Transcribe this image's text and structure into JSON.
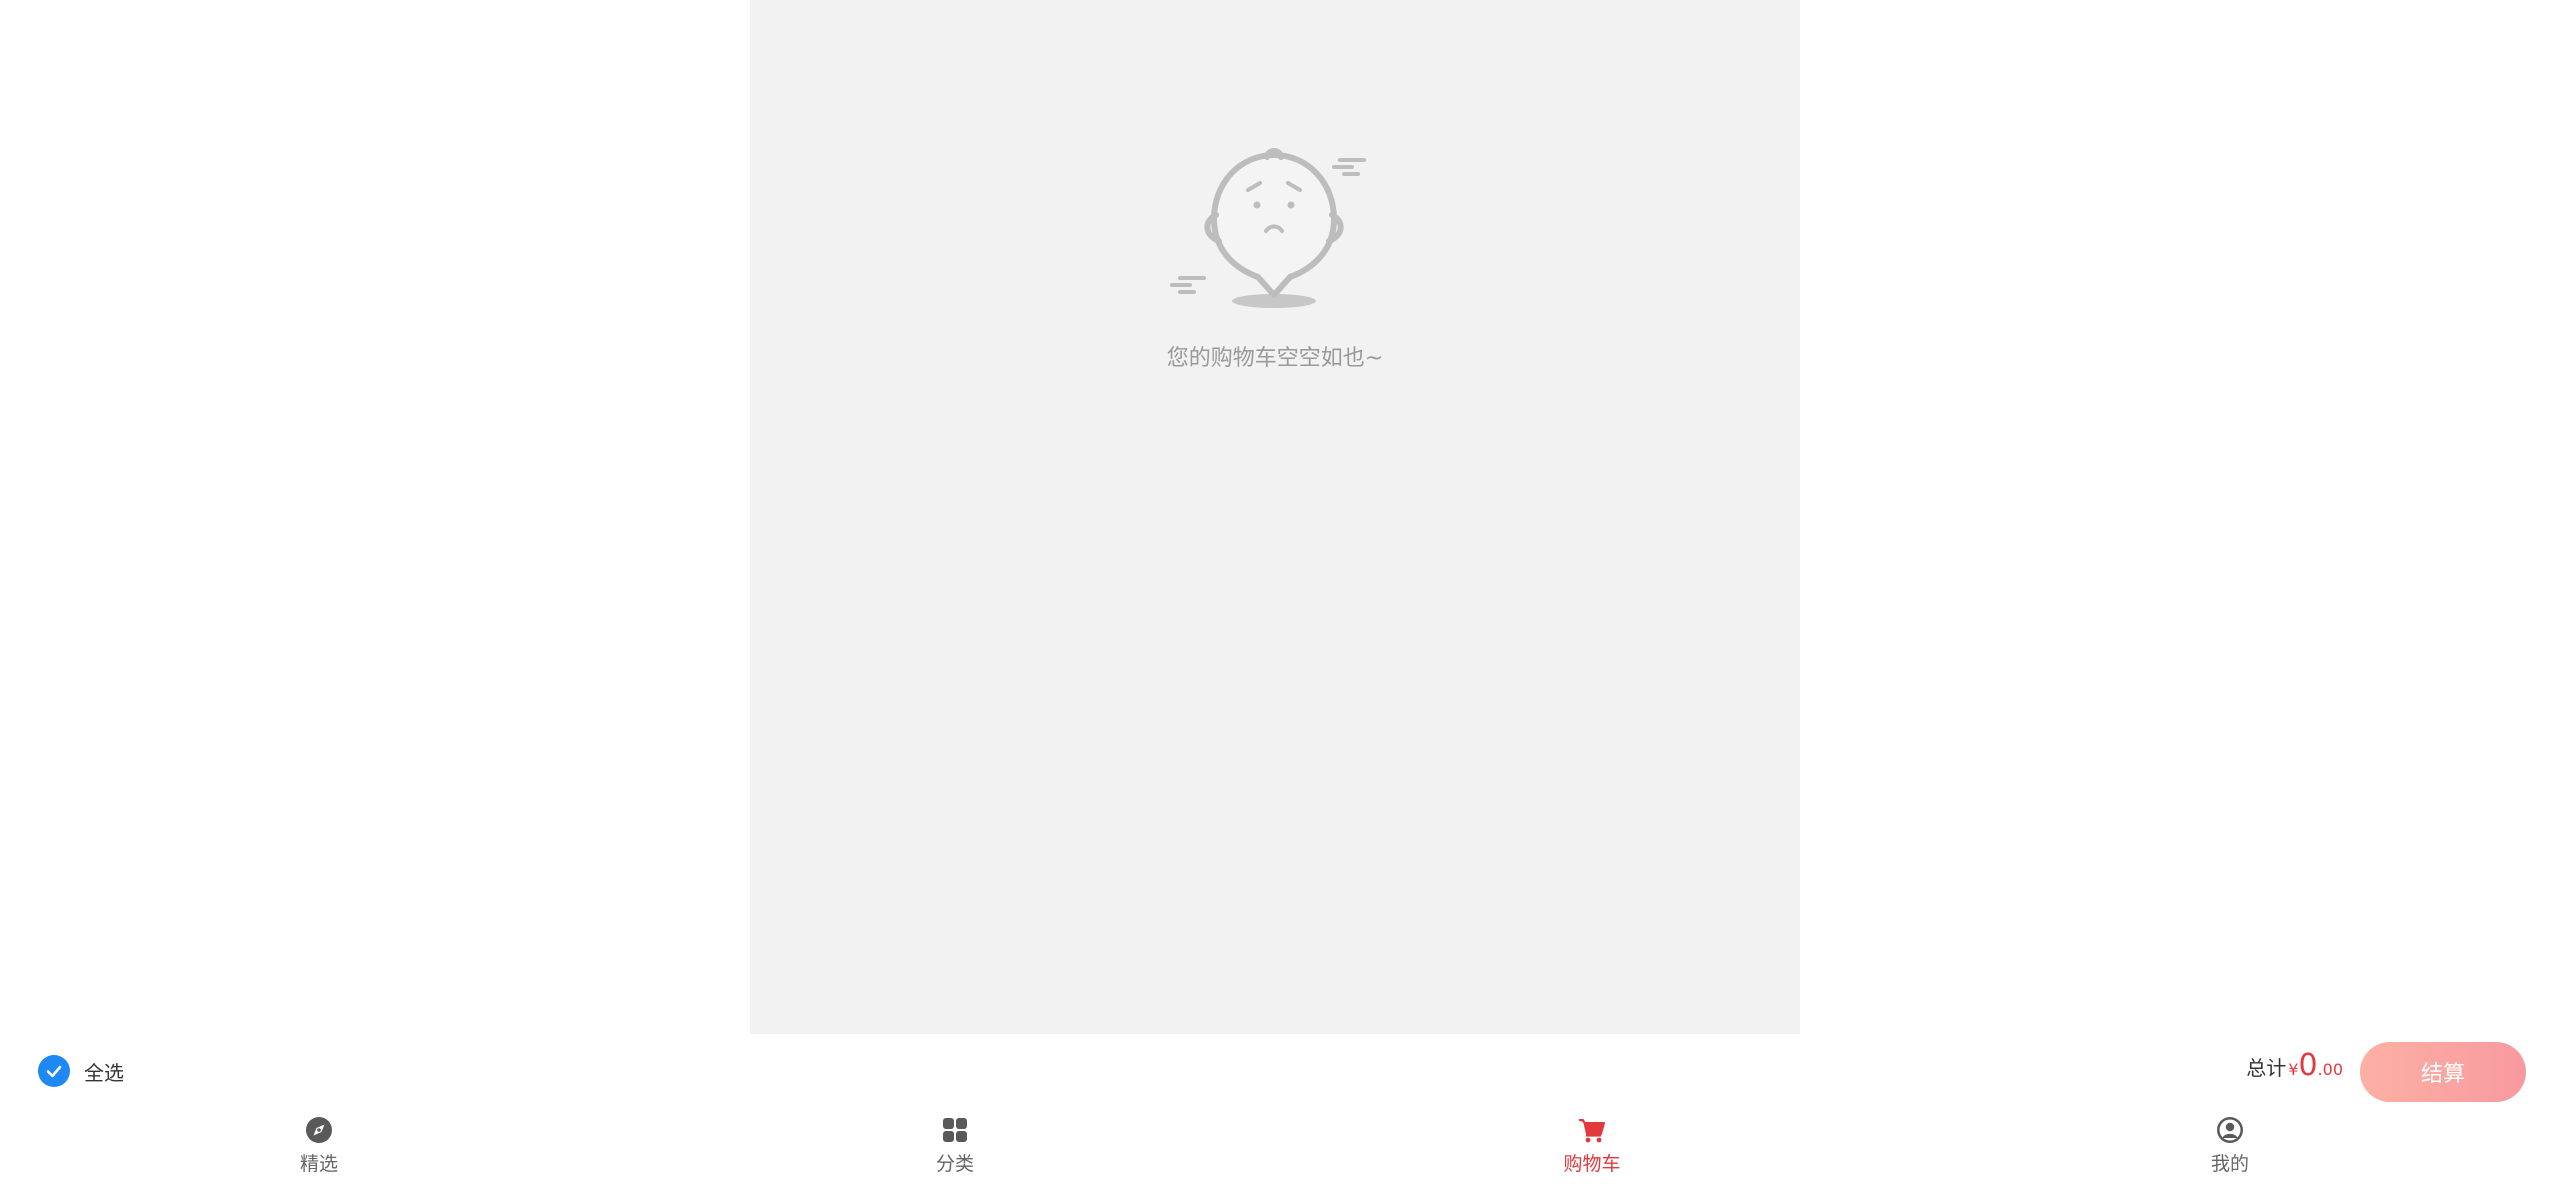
{
  "cart": {
    "empty_message": "您的购物车空空如也~"
  },
  "checkout_bar": {
    "select_all_label": "全选",
    "select_all_checked": true,
    "total_label": "总计",
    "currency_symbol": "¥",
    "total_integer": "0",
    "total_decimal": ".00",
    "checkout_label": "结算"
  },
  "tabbar": {
    "items": [
      {
        "label": "精选",
        "icon": "compass-icon"
      },
      {
        "label": "分类",
        "icon": "grid-icon"
      },
      {
        "label": "购物车",
        "icon": "cart-icon",
        "active": true
      },
      {
        "label": "我的",
        "icon": "user-icon"
      }
    ]
  },
  "colors": {
    "accent_red": "#e4393c",
    "check_blue": "#1e88f5",
    "panel_background": "#f2f2f2",
    "checkout_gradient_start": "#fdb0a4",
    "checkout_gradient_end": "#f79aa0"
  }
}
